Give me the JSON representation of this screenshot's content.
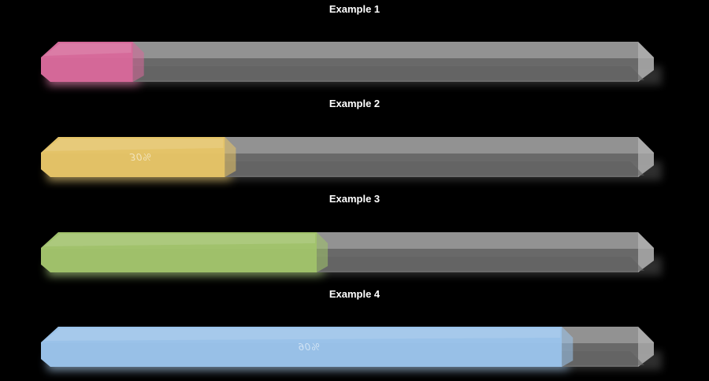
{
  "examples": [
    {
      "title": "Example 1",
      "progress": 0.15,
      "label": "",
      "color": "#d9689a",
      "glow": "#ff7ab7"
    },
    {
      "title": "Example 2",
      "progress": 0.3,
      "label": "30%",
      "color": "#e7c566",
      "glow": "#ffd86a"
    },
    {
      "title": "Example 3",
      "progress": 0.45,
      "label": "",
      "color": "#a1c46a",
      "glow": "#b5e27a"
    },
    {
      "title": "Example 4",
      "progress": 0.85,
      "label": "90%",
      "color": "#9ac4ec",
      "glow": "#a8d4ff"
    }
  ],
  "colors": {
    "background": "#000000",
    "track": "#9a9a9a",
    "track_dark": "#6f6f6f"
  }
}
